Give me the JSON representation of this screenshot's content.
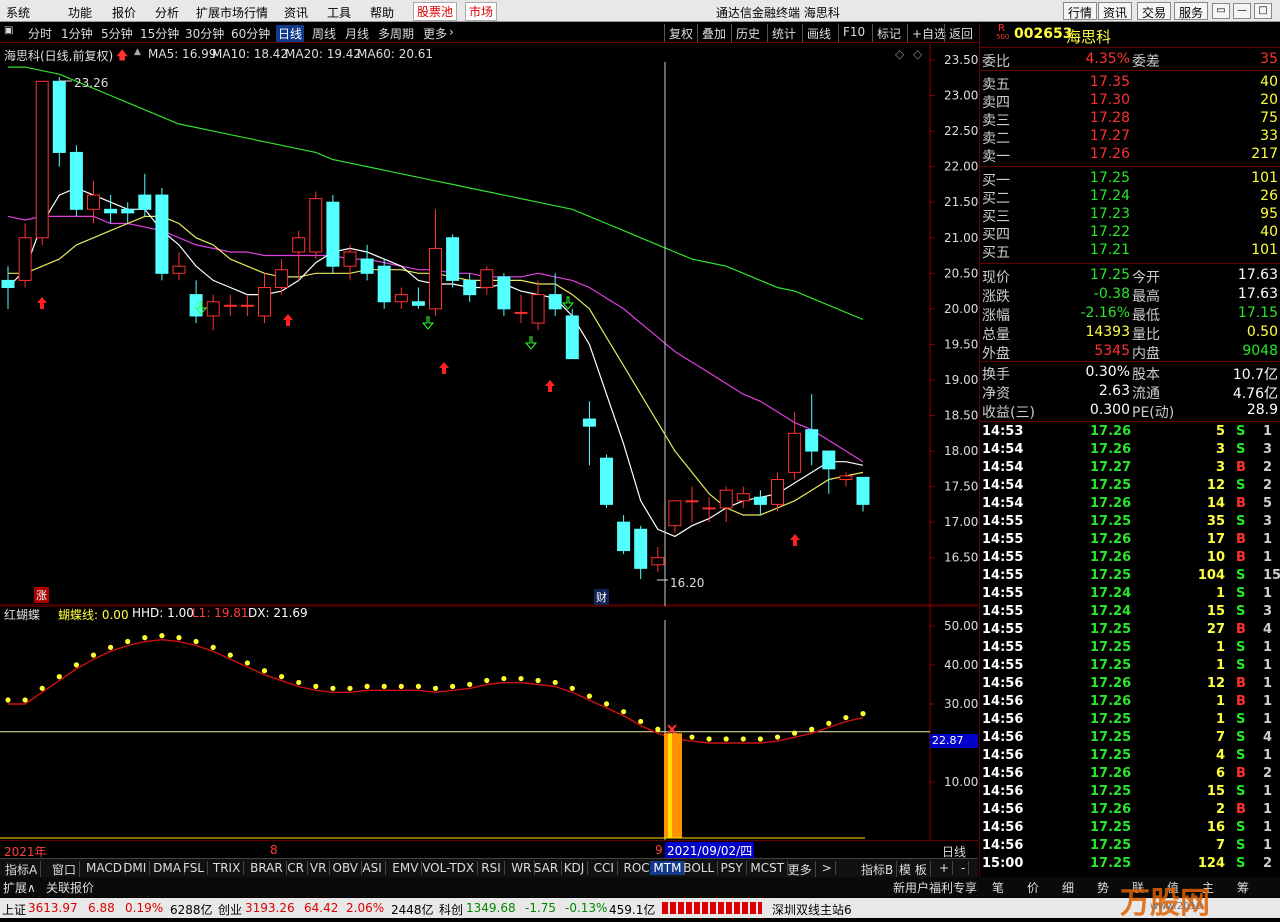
{
  "menubar": {
    "items": [
      "系统",
      "功能",
      "报价",
      "分析",
      "扩展市场行情",
      "资讯",
      "工具",
      "帮助"
    ],
    "hot_items": [
      "股票池",
      "市场"
    ],
    "title": "通达信金融终端 海思科",
    "right_buttons": [
      "行情",
      "资讯",
      "交易",
      "服务"
    ],
    "window_buttons": [
      "▭",
      "—",
      "□",
      "✕"
    ]
  },
  "periodbar": {
    "items": [
      "分时",
      "1分钟",
      "5分钟",
      "15分钟",
      "30分钟",
      "60分钟",
      "日线",
      "周线",
      "月线",
      "多周期",
      "更多"
    ],
    "active": "日线",
    "tools": [
      "复权",
      "叠加",
      "历史",
      "统计",
      "画线",
      "F10",
      "标记",
      "+自选",
      "返回"
    ]
  },
  "main_chart": {
    "title": "海思科(日线,前复权)",
    "ma_labels": [
      {
        "text": "MA5: 16.99",
        "color": "#ffffff"
      },
      {
        "text": "MA10: 18.42",
        "color": "#ffff40"
      },
      {
        "text": "MA20: 19.42",
        "color": "#ff40ff"
      },
      {
        "text": "MA60: 20.61",
        "color": "#40ff40"
      }
    ],
    "y_ticks": [
      "23.50",
      "23.00",
      "22.50",
      "22.00",
      "21.50",
      "21.00",
      "20.50",
      "20.00",
      "19.50",
      "19.00",
      "18.50",
      "18.00",
      "17.50",
      "17.00",
      "16.50"
    ],
    "high_label": "23.26",
    "low_label": "16.20",
    "zhang_label": "涨",
    "cai_label": "财"
  },
  "indicator": {
    "title": "红蝴蝶",
    "params": [
      {
        "text": "蝴蝶线: 0.00",
        "color": "#ffff40"
      },
      {
        "text": "HHD: 1.00",
        "color": "#ffffff"
      },
      {
        "text": "L1: 19.81",
        "color": "#ff4040"
      },
      {
        "text": "DX: 21.69",
        "color": "#ffffff"
      }
    ],
    "y_ticks": [
      "50.00",
      "40.00",
      "30.00",
      "20.00",
      "10.00"
    ],
    "current_value": "22.87"
  },
  "xaxis": {
    "labels": [
      "2021年",
      "8",
      "9"
    ],
    "cursor_date": "2021/09/02/四",
    "period": "日线"
  },
  "indicator_tabs": [
    "指标A",
    "窗口",
    "MACD",
    "DMI",
    "DMA",
    "FSL",
    "TRIX",
    "BRAR",
    "CR",
    "VR",
    "OBV",
    "ASI",
    "EMV",
    "VOL-TDX",
    "RSI",
    "WR",
    "SAR",
    "KDJ",
    "CCI",
    "ROC",
    "MTM",
    "BOLL",
    "PSY",
    "MCST",
    "更多",
    ">"
  ],
  "indicator_tabs_right": [
    "指标B",
    "模 板",
    "+",
    "-"
  ],
  "bottomrow": {
    "left": [
      "扩展∧",
      "关联报价"
    ],
    "middle": "新用户福利专享",
    "right": [
      "笔",
      "价",
      "细",
      "势",
      "联",
      "值",
      "主",
      "筹"
    ]
  },
  "statusbar": {
    "items": [
      {
        "label": "上证",
        "value": "3613.97",
        "chg": "6.88",
        "pct": "0.19%",
        "amt": "6288亿"
      },
      {
        "label": "创业",
        "value": "3193.26",
        "chg": "64.42",
        "pct": "2.06%",
        "amt": "2448亿"
      },
      {
        "label": "科创",
        "value": "1349.68",
        "chg": "-1.75",
        "pct": "-0.13%",
        "amt": "459.1亿"
      }
    ],
    "server": "深圳双线主站6",
    "watermark": "万股网",
    "watermark_url": "www.2010"
  },
  "quote": {
    "code": "002653",
    "name": "海思科",
    "r_badge": "R",
    "r_sub": "500",
    "weibi_label": "委比",
    "weibi": "4.35%",
    "weicha_label": "委差",
    "weicha": "35",
    "asks": [
      {
        "label": "卖五",
        "price": "17.35",
        "vol": "40"
      },
      {
        "label": "卖四",
        "price": "17.30",
        "vol": "20"
      },
      {
        "label": "卖三",
        "price": "17.28",
        "vol": "75"
      },
      {
        "label": "卖二",
        "price": "17.27",
        "vol": "33"
      },
      {
        "label": "卖一",
        "price": "17.26",
        "vol": "217"
      }
    ],
    "bids": [
      {
        "label": "买一",
        "price": "17.25",
        "vol": "101"
      },
      {
        "label": "买二",
        "price": "17.24",
        "vol": "26"
      },
      {
        "label": "买三",
        "price": "17.23",
        "vol": "95"
      },
      {
        "label": "买四",
        "price": "17.22",
        "vol": "40"
      },
      {
        "label": "买五",
        "price": "17.21",
        "vol": "101"
      }
    ],
    "stats": [
      {
        "l1": "现价",
        "v1": "17.25",
        "c1": "green",
        "l2": "今开",
        "v2": "17.63",
        "c2": "white"
      },
      {
        "l1": "涨跌",
        "v1": "-0.38",
        "c1": "green",
        "l2": "最高",
        "v2": "17.63",
        "c2": "white"
      },
      {
        "l1": "涨幅",
        "v1": "-2.16%",
        "c1": "green",
        "l2": "最低",
        "v2": "17.15",
        "c2": "green"
      },
      {
        "l1": "总量",
        "v1": "14393",
        "c1": "yel",
        "l2": "量比",
        "v2": "0.50",
        "c2": "yel"
      },
      {
        "l1": "外盘",
        "v1": "5345",
        "c1": "red",
        "l2": "内盘",
        "v2": "9048",
        "c2": "green"
      }
    ],
    "stats2": [
      {
        "l1": "换手",
        "v1": "0.30%",
        "l2": "股本",
        "v2": "10.7亿"
      },
      {
        "l1": "净资",
        "v1": "2.63",
        "l2": "流通",
        "v2": "4.76亿"
      },
      {
        "l1": "收益(三)",
        "v1": "0.300",
        "l2": "PE(动)",
        "v2": "28.9"
      }
    ],
    "ticks": [
      {
        "t": "14:53",
        "p": "17.26",
        "v": "5",
        "s": "S",
        "n": "1"
      },
      {
        "t": "14:54",
        "p": "17.26",
        "v": "3",
        "s": "S",
        "n": "3"
      },
      {
        "t": "14:54",
        "p": "17.27",
        "v": "3",
        "s": "B",
        "n": "2"
      },
      {
        "t": "14:54",
        "p": "17.25",
        "v": "12",
        "s": "S",
        "n": "2"
      },
      {
        "t": "14:54",
        "p": "17.26",
        "v": "14",
        "s": "B",
        "n": "5"
      },
      {
        "t": "14:55",
        "p": "17.25",
        "v": "35",
        "s": "S",
        "n": "3"
      },
      {
        "t": "14:55",
        "p": "17.26",
        "v": "17",
        "s": "B",
        "n": "1"
      },
      {
        "t": "14:55",
        "p": "17.26",
        "v": "10",
        "s": "B",
        "n": "1"
      },
      {
        "t": "14:55",
        "p": "17.25",
        "v": "104",
        "s": "S",
        "n": "15"
      },
      {
        "t": "14:55",
        "p": "17.24",
        "v": "1",
        "s": "S",
        "n": "1"
      },
      {
        "t": "14:55",
        "p": "17.24",
        "v": "15",
        "s": "S",
        "n": "3"
      },
      {
        "t": "14:55",
        "p": "17.25",
        "v": "27",
        "s": "B",
        "n": "4"
      },
      {
        "t": "14:55",
        "p": "17.25",
        "v": "1",
        "s": "S",
        "n": "1"
      },
      {
        "t": "14:55",
        "p": "17.25",
        "v": "1",
        "s": "S",
        "n": "1"
      },
      {
        "t": "14:56",
        "p": "17.26",
        "v": "12",
        "s": "B",
        "n": "1"
      },
      {
        "t": "14:56",
        "p": "17.26",
        "v": "1",
        "s": "B",
        "n": "1"
      },
      {
        "t": "14:56",
        "p": "17.25",
        "v": "1",
        "s": "S",
        "n": "1"
      },
      {
        "t": "14:56",
        "p": "17.25",
        "v": "7",
        "s": "S",
        "n": "4"
      },
      {
        "t": "14:56",
        "p": "17.25",
        "v": "4",
        "s": "S",
        "n": "1"
      },
      {
        "t": "14:56",
        "p": "17.26",
        "v": "6",
        "s": "B",
        "n": "2"
      },
      {
        "t": "14:56",
        "p": "17.25",
        "v": "15",
        "s": "S",
        "n": "1"
      },
      {
        "t": "14:56",
        "p": "17.26",
        "v": "2",
        "s": "B",
        "n": "1"
      },
      {
        "t": "14:56",
        "p": "17.25",
        "v": "16",
        "s": "S",
        "n": "1"
      },
      {
        "t": "14:56",
        "p": "17.25",
        "v": "7",
        "s": "S",
        "n": "1"
      },
      {
        "t": "15:00",
        "p": "17.25",
        "v": "124",
        "s": "S",
        "n": "2"
      }
    ]
  },
  "chart_data": {
    "type": "candlestick",
    "price_range": [
      16.0,
      23.6
    ],
    "candles": [
      [
        20.4,
        20.3,
        20.6,
        20.0
      ],
      [
        20.4,
        21.0,
        21.2,
        20.3
      ],
      [
        21.0,
        23.2,
        23.2,
        20.9
      ],
      [
        23.2,
        22.2,
        23.26,
        22.0
      ],
      [
        22.2,
        21.4,
        22.3,
        21.3
      ],
      [
        21.4,
        21.6,
        21.8,
        21.2
      ],
      [
        21.4,
        21.35,
        21.6,
        21.2
      ],
      [
        21.4,
        21.35,
        21.5,
        21.2
      ],
      [
        21.6,
        21.4,
        21.9,
        21.3
      ],
      [
        21.6,
        20.5,
        21.7,
        20.4
      ],
      [
        20.5,
        20.6,
        20.8,
        20.4
      ],
      [
        20.2,
        19.9,
        20.4,
        19.8
      ],
      [
        19.9,
        20.1,
        20.2,
        19.7
      ],
      [
        20.05,
        20.05,
        20.2,
        19.9
      ],
      [
        20.05,
        20.05,
        20.2,
        19.9
      ],
      [
        19.9,
        20.3,
        20.5,
        19.8
      ],
      [
        20.3,
        20.55,
        20.7,
        20.2
      ],
      [
        20.8,
        21.0,
        21.1,
        20.4
      ],
      [
        20.8,
        21.55,
        21.65,
        20.7
      ],
      [
        21.5,
        20.6,
        21.6,
        20.5
      ],
      [
        20.6,
        20.8,
        20.9,
        20.4
      ],
      [
        20.7,
        20.5,
        20.9,
        20.4
      ],
      [
        20.6,
        20.1,
        20.7,
        20.0
      ],
      [
        20.1,
        20.2,
        20.3,
        20.0
      ],
      [
        20.1,
        20.05,
        20.3,
        20.0
      ],
      [
        20.0,
        20.85,
        21.4,
        19.9
      ],
      [
        21.0,
        20.4,
        21.05,
        20.3
      ],
      [
        20.4,
        20.2,
        20.5,
        20.1
      ],
      [
        20.3,
        20.55,
        20.6,
        20.2
      ],
      [
        20.45,
        20.0,
        20.5,
        19.9
      ],
      [
        19.95,
        19.95,
        20.2,
        19.8
      ],
      [
        19.8,
        20.2,
        20.4,
        19.7
      ],
      [
        20.2,
        20.0,
        20.5,
        19.9
      ],
      [
        19.9,
        19.3,
        20.0,
        19.3
      ],
      [
        18.45,
        18.35,
        18.7,
        17.8
      ],
      [
        17.9,
        17.25,
        17.95,
        17.2
      ],
      [
        17.0,
        16.6,
        17.1,
        16.55
      ],
      [
        16.9,
        16.35,
        16.95,
        16.2
      ],
      [
        16.4,
        16.5,
        16.65,
        16.3
      ],
      [
        16.95,
        17.3,
        17.3,
        16.85
      ],
      [
        17.3,
        17.3,
        17.5,
        17.0
      ],
      [
        17.2,
        17.2,
        17.35,
        17.0
      ],
      [
        17.2,
        17.45,
        17.5,
        17.0
      ],
      [
        17.3,
        17.4,
        17.5,
        17.2
      ],
      [
        17.35,
        17.25,
        17.45,
        17.1
      ],
      [
        17.25,
        17.6,
        17.7,
        17.15
      ],
      [
        17.7,
        18.25,
        18.55,
        17.6
      ],
      [
        18.3,
        18.0,
        18.8,
        17.8
      ],
      [
        18.0,
        17.75,
        18.0,
        17.4
      ],
      [
        17.6,
        17.65,
        17.7,
        17.5
      ],
      [
        17.63,
        17.25,
        17.63,
        17.15
      ]
    ],
    "ma5": [
      20.3,
      20.55,
      21.2,
      21.6,
      21.7,
      21.6,
      21.5,
      21.4,
      21.4,
      21.1,
      20.9,
      20.6,
      20.4,
      20.3,
      20.2,
      20.2,
      20.25,
      20.4,
      20.65,
      20.8,
      20.85,
      20.8,
      20.7,
      20.6,
      20.4,
      20.35,
      20.35,
      20.3,
      20.3,
      20.35,
      20.25,
      20.2,
      20.15,
      19.9,
      19.5,
      18.8,
      18.1,
      17.3,
      16.9,
      16.8,
      16.95,
      17.05,
      17.2,
      17.3,
      17.35,
      17.4,
      17.55,
      17.7,
      17.85,
      17.85,
      17.8
    ],
    "ma10": [
      20.5,
      20.5,
      20.6,
      20.7,
      20.9,
      21.0,
      21.1,
      21.2,
      21.3,
      21.3,
      21.2,
      21.0,
      20.9,
      20.7,
      20.6,
      20.5,
      20.45,
      20.45,
      20.5,
      20.5,
      20.5,
      20.55,
      20.55,
      20.55,
      20.5,
      20.5,
      20.45,
      20.4,
      20.4,
      20.4,
      20.4,
      20.35,
      20.35,
      20.2,
      20.0,
      19.6,
      19.2,
      18.8,
      18.4,
      18.0,
      17.7,
      17.4,
      17.2,
      17.1,
      17.1,
      17.2,
      17.3,
      17.45,
      17.6,
      17.65,
      17.7
    ],
    "ma20": [
      21.3,
      21.25,
      21.3,
      21.3,
      21.3,
      21.3,
      21.2,
      21.2,
      21.15,
      21.1,
      21.0,
      20.9,
      20.85,
      20.8,
      20.8,
      20.75,
      20.75,
      20.75,
      20.75,
      20.75,
      20.7,
      20.7,
      20.65,
      20.6,
      20.55,
      20.55,
      20.5,
      20.5,
      20.45,
      20.45,
      20.45,
      20.5,
      20.45,
      20.4,
      20.3,
      20.15,
      20.0,
      19.8,
      19.6,
      19.4,
      19.25,
      19.1,
      18.95,
      18.8,
      18.7,
      18.55,
      18.4,
      18.3,
      18.15,
      18.0,
      17.85
    ],
    "ma60": [
      23.4,
      23.4,
      23.35,
      23.3,
      23.2,
      23.1,
      23.0,
      22.9,
      22.8,
      22.7,
      22.6,
      22.55,
      22.5,
      22.45,
      22.4,
      22.35,
      22.3,
      22.25,
      22.2,
      22.1,
      22.05,
      22.0,
      21.95,
      21.9,
      21.85,
      21.8,
      21.75,
      21.7,
      21.65,
      21.6,
      21.55,
      21.5,
      21.45,
      21.4,
      21.3,
      21.2,
      21.1,
      21.0,
      20.9,
      20.8,
      20.7,
      20.65,
      20.6,
      20.5,
      20.4,
      20.3,
      20.25,
      20.15,
      20.05,
      19.95,
      19.85
    ],
    "butterfly": [
      30,
      30,
      33,
      36,
      39,
      41.5,
      43.5,
      45,
      46,
      46.5,
      46,
      45,
      43.5,
      41.5,
      39.5,
      37.5,
      36,
      34.5,
      33.5,
      33,
      33,
      33.5,
      33.5,
      33.5,
      33.5,
      33,
      33.5,
      34,
      35,
      35.5,
      35.5,
      35,
      34.5,
      33,
      31,
      29,
      27,
      24.5,
      22.5,
      21,
      20.5,
      20,
      20,
      20,
      20,
      20.5,
      21.5,
      22.5,
      24,
      25.5,
      26.5
    ],
    "butterfly_ylim": [
      0,
      57
    ]
  }
}
